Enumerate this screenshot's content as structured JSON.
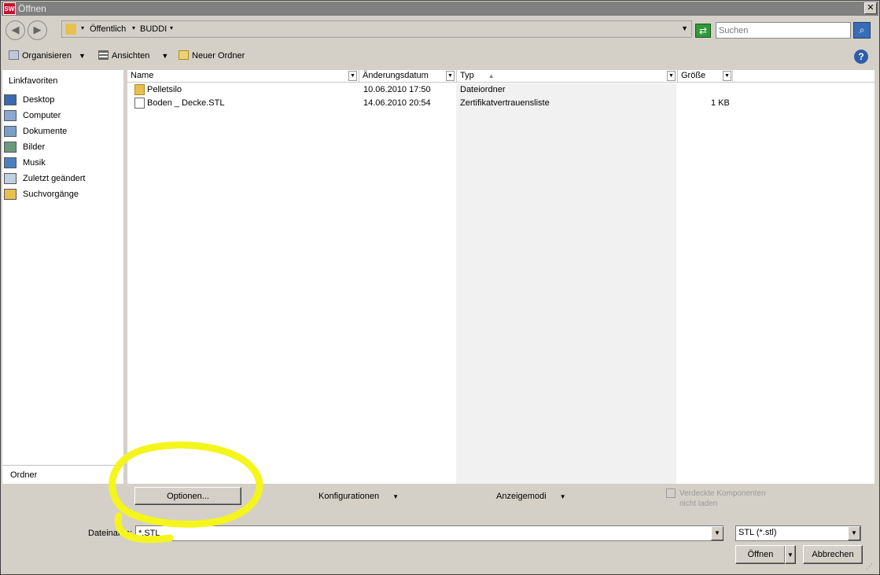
{
  "window": {
    "title": "Öffnen",
    "app_icon_text": "SW",
    "close_glyph": "✕"
  },
  "address": {
    "crumbs": [
      "Öffentlich",
      "BUDDI"
    ],
    "search_placeholder": "Suchen"
  },
  "toolbar": {
    "organize_label": "Organisieren",
    "views_label": "Ansichten",
    "new_folder_label": "Neuer Ordner",
    "help_glyph": "?"
  },
  "navpane": {
    "header": "Linkfavoriten",
    "items": [
      {
        "label": "Desktop",
        "icon": "desktop-icon"
      },
      {
        "label": "Computer",
        "icon": "computer-icon"
      },
      {
        "label": "Dokumente",
        "icon": "documents-icon"
      },
      {
        "label": "Bilder",
        "icon": "pictures-icon"
      },
      {
        "label": "Musik",
        "icon": "music-icon"
      },
      {
        "label": "Zuletzt geändert",
        "icon": "recent-icon"
      },
      {
        "label": "Suchvorgänge",
        "icon": "searches-folder-icon"
      }
    ],
    "folder_bar_label": "Ordner"
  },
  "filelist": {
    "columns": {
      "name": "Name",
      "date": "Änderungsdatum",
      "type": "Typ",
      "size": "Größe"
    },
    "rows": [
      {
        "name": "Pelletsilo",
        "date": "10.06.2010 17:50",
        "type": "Dateiordner",
        "size": "",
        "icon": "folder-icon"
      },
      {
        "name": "Boden _ Decke.STL",
        "date": "14.06.2010 20:54",
        "type": "Zertifikatvertrauensliste",
        "size": "1 KB",
        "icon": "certificate-file-icon"
      }
    ]
  },
  "bottom": {
    "options_label": "Optionen...",
    "configurations_label": "Konfigurationen",
    "display_mode_label": "Anzeigemodi",
    "hidden_components_label": "Verdeckte Komponenten nicht laden",
    "filename_label": "Dateiname:",
    "filename_value": "*.STL",
    "filter_value": "STL (*.stl)",
    "open_label": "Öffnen",
    "cancel_label": "Abbrechen"
  },
  "colors": {
    "annotation": "#f5f51e",
    "title_bar": "#808080",
    "dialog_face": "#d4d0c8"
  }
}
